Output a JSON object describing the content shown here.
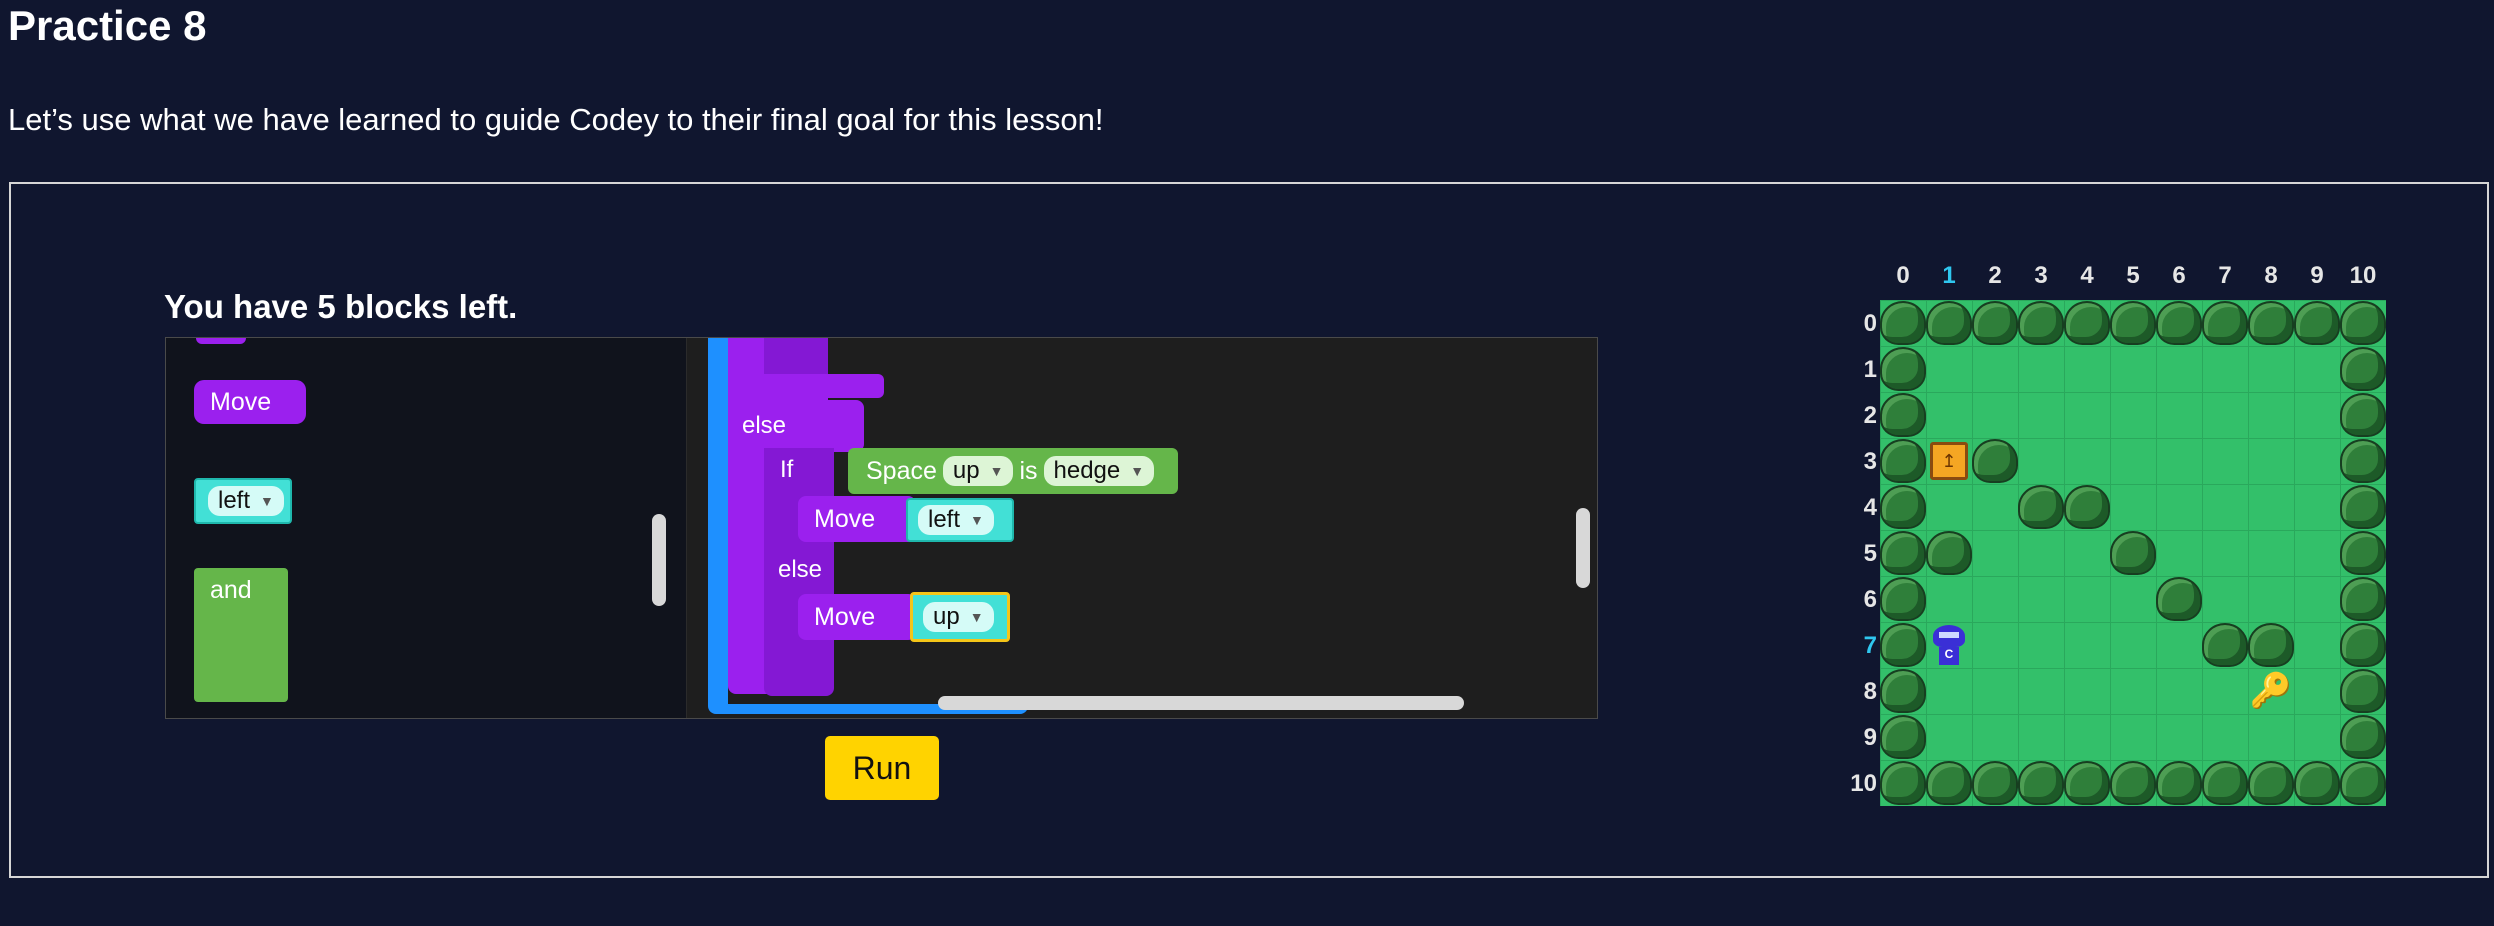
{
  "page": {
    "title": "Practice 8",
    "subtitle": "Let’s use what we have learned to guide Codey to their final goal for this lesson!"
  },
  "editor": {
    "blocks_left": "You have 5 blocks left.",
    "toolbox": {
      "move_label": "Move",
      "left_label": "left",
      "and_label": "and"
    },
    "workspace": {
      "else1": "else",
      "if_label": "If",
      "space_label": "Space",
      "dir_up": "up",
      "is_label": "is",
      "hedge_label": "hedge",
      "move1_label": "Move",
      "move1_dir": "left",
      "else2": "else",
      "move2_label": "Move",
      "move2_dir": "up"
    },
    "run_label": "Run",
    "dropdown_arrow": "▼"
  },
  "grid": {
    "columns": [
      "0",
      "1",
      "2",
      "3",
      "4",
      "5",
      "6",
      "7",
      "8",
      "9",
      "10"
    ],
    "rows": [
      "0",
      "1",
      "2",
      "3",
      "4",
      "5",
      "6",
      "7",
      "8",
      "9",
      "10"
    ],
    "highlight_col": 1,
    "highlight_row": 7,
    "chest_icon": "↥",
    "key_icon": "🔑",
    "robot_letter": "C",
    "colors": {
      "grass": "#33c06a",
      "highlight": "#2fc7ef",
      "run_button": "#ffd300"
    }
  }
}
